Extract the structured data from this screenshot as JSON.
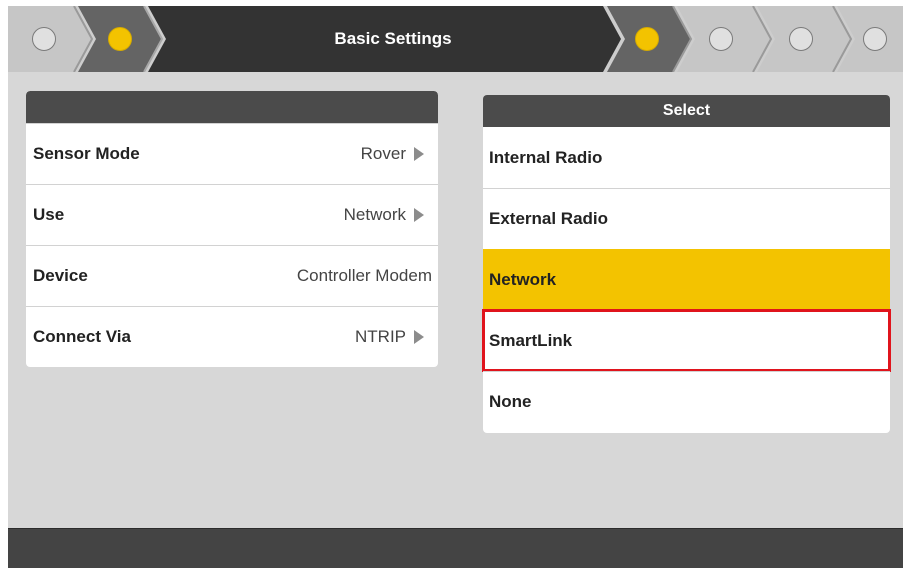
{
  "header": {
    "title": "Basic Settings",
    "steps": [
      {
        "state": "inactive",
        "icon": "step-dot-icon"
      },
      {
        "state": "active",
        "icon": "step-dot-icon"
      },
      {
        "state": "active",
        "icon": "step-dot-icon"
      },
      {
        "state": "inactive",
        "icon": "step-dot-icon"
      },
      {
        "state": "inactive",
        "icon": "step-dot-icon"
      },
      {
        "state": "inactive",
        "icon": "step-dot-icon"
      }
    ]
  },
  "settings": [
    {
      "label": "Sensor Mode",
      "value": "Rover",
      "has_arrow": true
    },
    {
      "label": "Use",
      "value": "Network",
      "has_arrow": true
    },
    {
      "label": "Device",
      "value": "Controller Modem",
      "has_arrow": false
    },
    {
      "label": "Connect Via",
      "value": "NTRIP",
      "has_arrow": true
    }
  ],
  "select": {
    "title": "Select",
    "options": [
      {
        "label": "Internal Radio",
        "state": "normal"
      },
      {
        "label": "External Radio",
        "state": "normal"
      },
      {
        "label": "Network",
        "state": "selected"
      },
      {
        "label": "SmartLink",
        "state": "highlighted"
      },
      {
        "label": "None",
        "state": "normal"
      }
    ]
  },
  "colors": {
    "accent": "#f3c300",
    "dark": "#4b4b4b",
    "highlight_border": "#e0141c",
    "background": "#d7d7d7"
  }
}
